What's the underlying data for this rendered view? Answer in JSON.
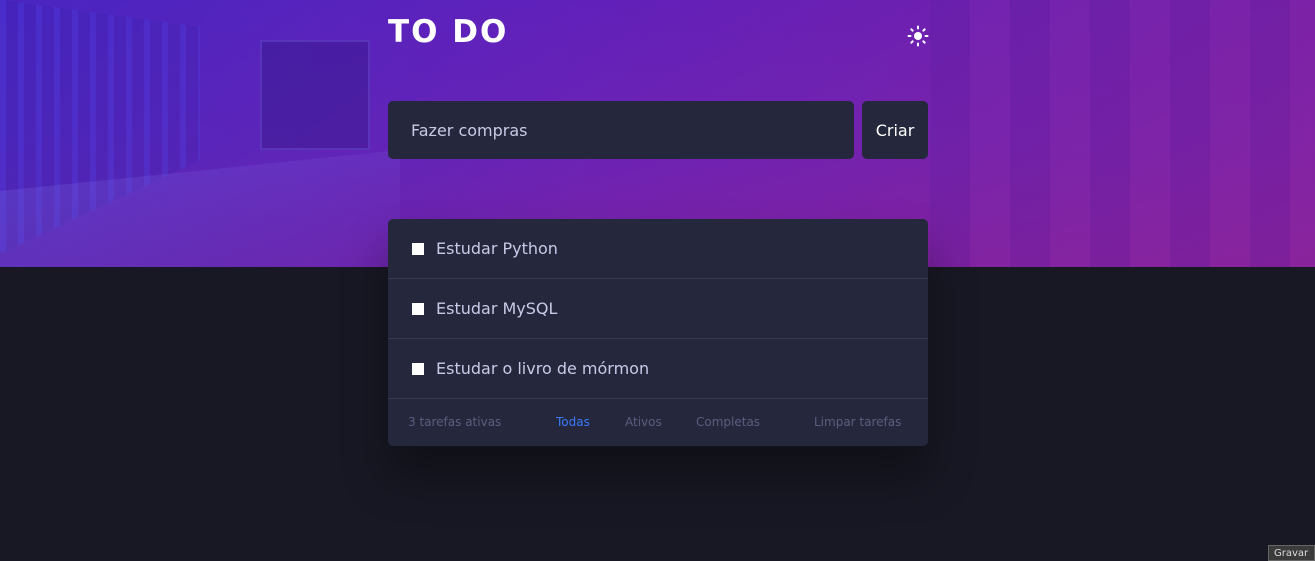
{
  "header": {
    "title": "TO DO",
    "theme_icon": "sun-icon"
  },
  "new_task": {
    "placeholder": "Fazer compras",
    "value": "",
    "create_label": "Criar"
  },
  "tasks": [
    {
      "label": "Estudar Python",
      "completed": false
    },
    {
      "label": "Estudar MySQL",
      "completed": false
    },
    {
      "label": "Estudar o livro de mórmon",
      "completed": false
    }
  ],
  "footer": {
    "count": "3 tarefas ativas",
    "filters": [
      {
        "label": "Todas",
        "active": true
      },
      {
        "label": "Ativos",
        "active": false
      },
      {
        "label": "Completas",
        "active": false
      }
    ],
    "clear_label": "Limpar tarefas"
  },
  "record_label": "Gravar",
  "colors": {
    "background": "#181824",
    "card": "#25273c",
    "text": "#c8cbe7",
    "muted": "#5b5e7e",
    "accent": "#3a7bfd"
  }
}
